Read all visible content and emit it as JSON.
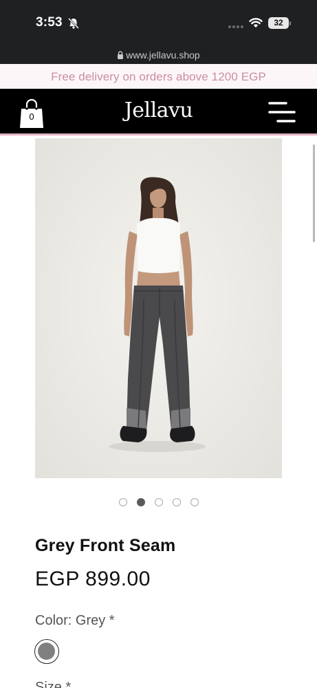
{
  "status_bar": {
    "time": "3:53",
    "battery": "32"
  },
  "browser": {
    "url": "www.jellavu.shop"
  },
  "promo": {
    "text": "Free delivery on orders above 1200 EGP"
  },
  "header": {
    "brand": "Jellavu",
    "cart_count": "0"
  },
  "carousel": {
    "total": 5,
    "active_index": 1
  },
  "product": {
    "title": "Grey Front Seam",
    "price": "EGP 899.00",
    "color_label": "Color: Grey *",
    "size_label": "Size *",
    "swatch_color": "#808080"
  },
  "colors": {
    "header_bg": "#000000",
    "promo_text": "#c98ea3",
    "accent_line": "#e8b4c5"
  }
}
